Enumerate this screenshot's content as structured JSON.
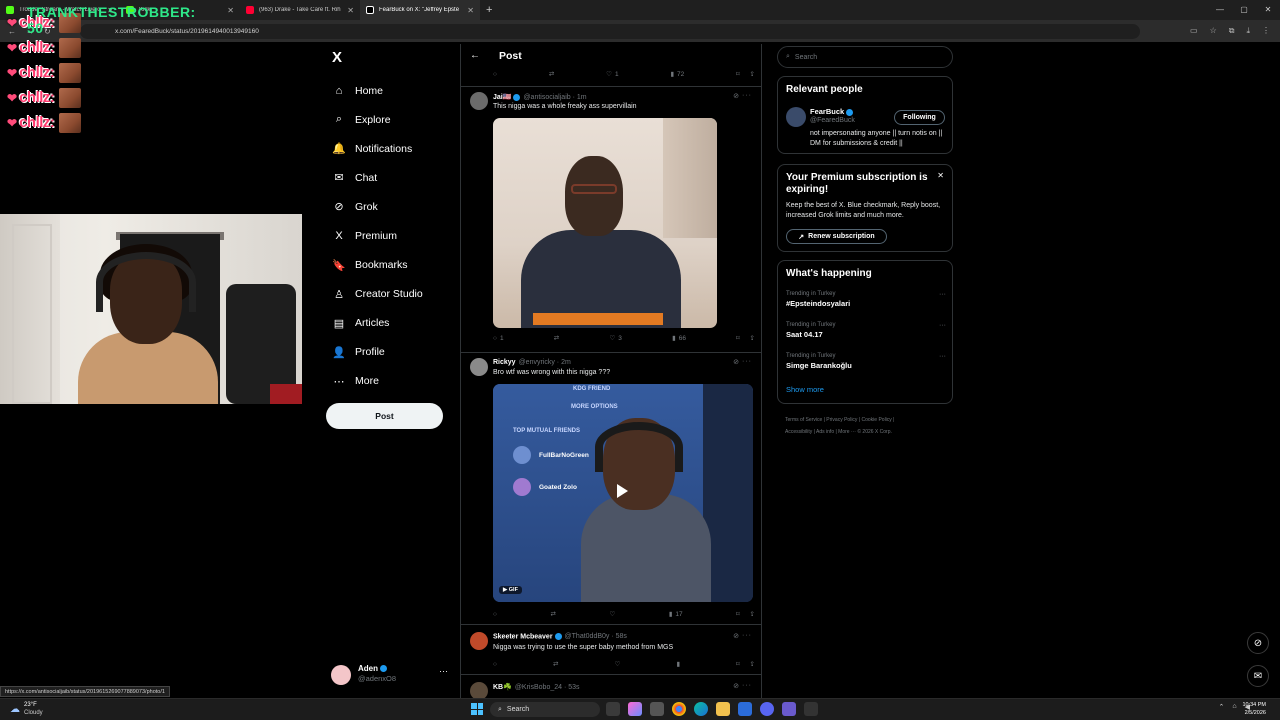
{
  "browser": {
    "tabs": [
      {
        "label": "Trodder Stream - Watch Live o",
        "color": "#53fc18"
      },
      {
        "label": "Kick",
        "color": "#53fc18"
      },
      {
        "label": "(963) Drake - Take Care ft. Rih",
        "color": "#ff0033"
      },
      {
        "label": "FearBuck on X: \"Jeffrey Epste",
        "color": "#ffffff"
      }
    ],
    "new_tab": "+",
    "url": "x.com/FearedBuck/status/2019614940013949160",
    "status_url": "https://x.com/antisocialjaib/status/2019615269077889073/photo/1"
  },
  "overlay": {
    "banner": "TRANKTHESTROBBER: 50",
    "chillz": [
      "chllz:",
      "chllz:",
      "chllz:",
      "chllz:",
      "chllz:"
    ]
  },
  "nav": {
    "logo": "X",
    "items": [
      {
        "label": "Home",
        "icon": "⌂"
      },
      {
        "label": "Explore",
        "icon": "⌕"
      },
      {
        "label": "Notifications",
        "icon": "🔔"
      },
      {
        "label": "Chat",
        "icon": "✉"
      },
      {
        "label": "Grok",
        "icon": "⊘"
      },
      {
        "label": "Premium",
        "icon": "X"
      },
      {
        "label": "Bookmarks",
        "icon": "🔖"
      },
      {
        "label": "Creator Studio",
        "icon": "♙"
      },
      {
        "label": "Articles",
        "icon": "▤"
      },
      {
        "label": "Profile",
        "icon": "👤"
      },
      {
        "label": "More",
        "icon": "⋯"
      }
    ],
    "post_button": "Post",
    "account": {
      "name": "Aden",
      "handle": "@adenxO8"
    }
  },
  "main": {
    "title": "Post",
    "top_actions": {
      "likes": "1",
      "views": "72"
    },
    "tweets": [
      {
        "name": "Jai🇺🇸",
        "handle": "@antisocialjaib · 1m",
        "text": "This nigga was a whole freaky ass supervillain",
        "replies": "1",
        "likes": "3",
        "views": "66"
      },
      {
        "name": "Rickyy",
        "handle": "@envyricky · 2m",
        "text": "Bro wtf was wrong with this nigga ???",
        "views": "17",
        "media_menu": [
          "KDG FRIEND",
          "MORE OPTIONS",
          "TOP MUTUAL FRIENDS"
        ],
        "media_friends": [
          "FullBarNoGreen",
          "Goated Zolo"
        ],
        "gif_label": "GIF"
      },
      {
        "name": "Skeeter Mcbeaver",
        "handle": "@That0ddB0y · 58s",
        "text": "Nigga was trying to use the super baby method from MGS"
      },
      {
        "name": "KB☘️",
        "handle": "@KrisBobo_24 · 53s",
        "text": ""
      }
    ]
  },
  "sidebar": {
    "search_placeholder": "Search",
    "relevant": {
      "title": "Relevant people",
      "name": "FearBuck",
      "handle": "@FearedBuck",
      "follow_label": "Following",
      "bio": "not impersonating anyone || turn notis on || DM for submissions & credit ||"
    },
    "premium": {
      "title": "Your Premium subscription is expiring!",
      "desc": "Keep the best of X. Blue checkmark, Reply boost, increased Grok limits and much more.",
      "button": "Renew subscription"
    },
    "happening": {
      "title": "What's happening",
      "trends": [
        {
          "category": "Trending in Turkey",
          "name": "#Epsteindosyalari"
        },
        {
          "category": "Trending in Turkey",
          "name": "Saat 04.17"
        },
        {
          "category": "Trending in Turkey",
          "name": "Simge Barankoğlu"
        }
      ],
      "show_more": "Show more"
    },
    "footer_line1": "Terms of Service  |  Privacy Policy  |  Cookie Policy  |",
    "footer_line2": "Accessibility  |  Ads info  |  More ···  © 2026 X Corp."
  },
  "taskbar": {
    "temp": "23°F",
    "condition": "Cloudy",
    "search": "Search",
    "time": "10:34 PM",
    "date": "2/5/2026"
  }
}
